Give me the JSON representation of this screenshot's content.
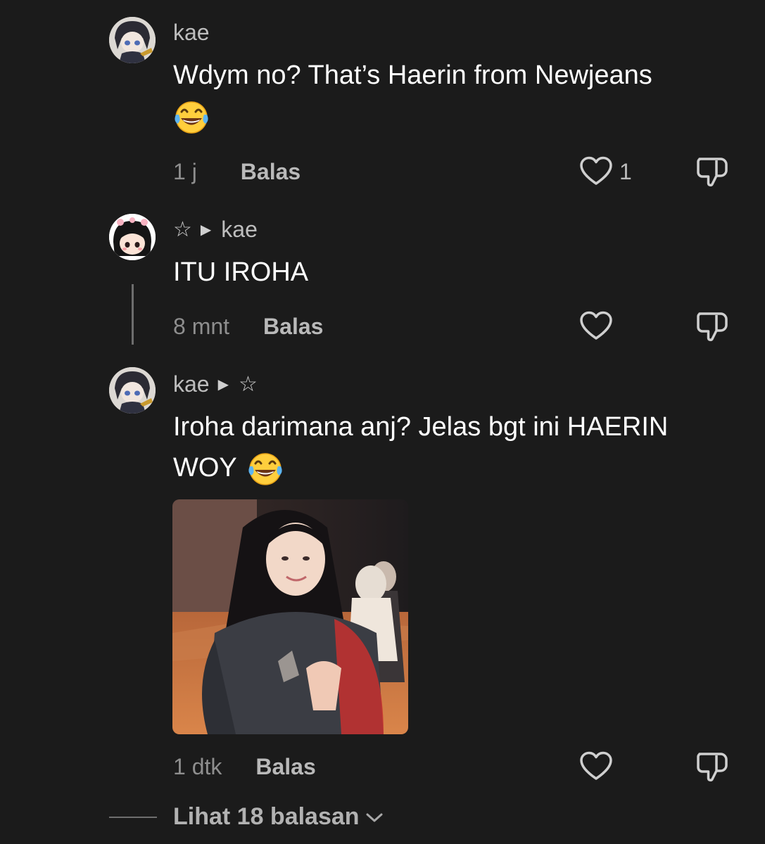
{
  "comments": [
    {
      "author": "kae",
      "text": "Wdym no? That’s Haerin from Newjeans",
      "time": "1 j",
      "reply_label": "Balas",
      "likes": "1"
    },
    {
      "author_prefix": "☆",
      "author": "kae",
      "text": "ITU IROHA",
      "time": "8 mnt",
      "reply_label": "Balas"
    },
    {
      "author": "kae",
      "author_suffix": "☆",
      "text_line1": "Iroha darimana anj? Jelas bgt ini HAERIN",
      "text_line2": "WOY",
      "time": "1 dtk",
      "reply_label": "Balas"
    }
  ],
  "view_replies": {
    "label": "Lihat 18 balasan"
  },
  "icons": {
    "like": "heart-outline-icon",
    "dislike": "thumbs-down-outline-icon",
    "reply_arrow": "play-triangle-icon",
    "emoji": "face-with-tears-of-joy-emoji",
    "expand": "chevron-down-icon"
  },
  "colors": {
    "background": "#1b1b1b",
    "text": "#ffffff",
    "secondary_text": "#8e8e8e",
    "action_text": "#b9b9b9"
  }
}
